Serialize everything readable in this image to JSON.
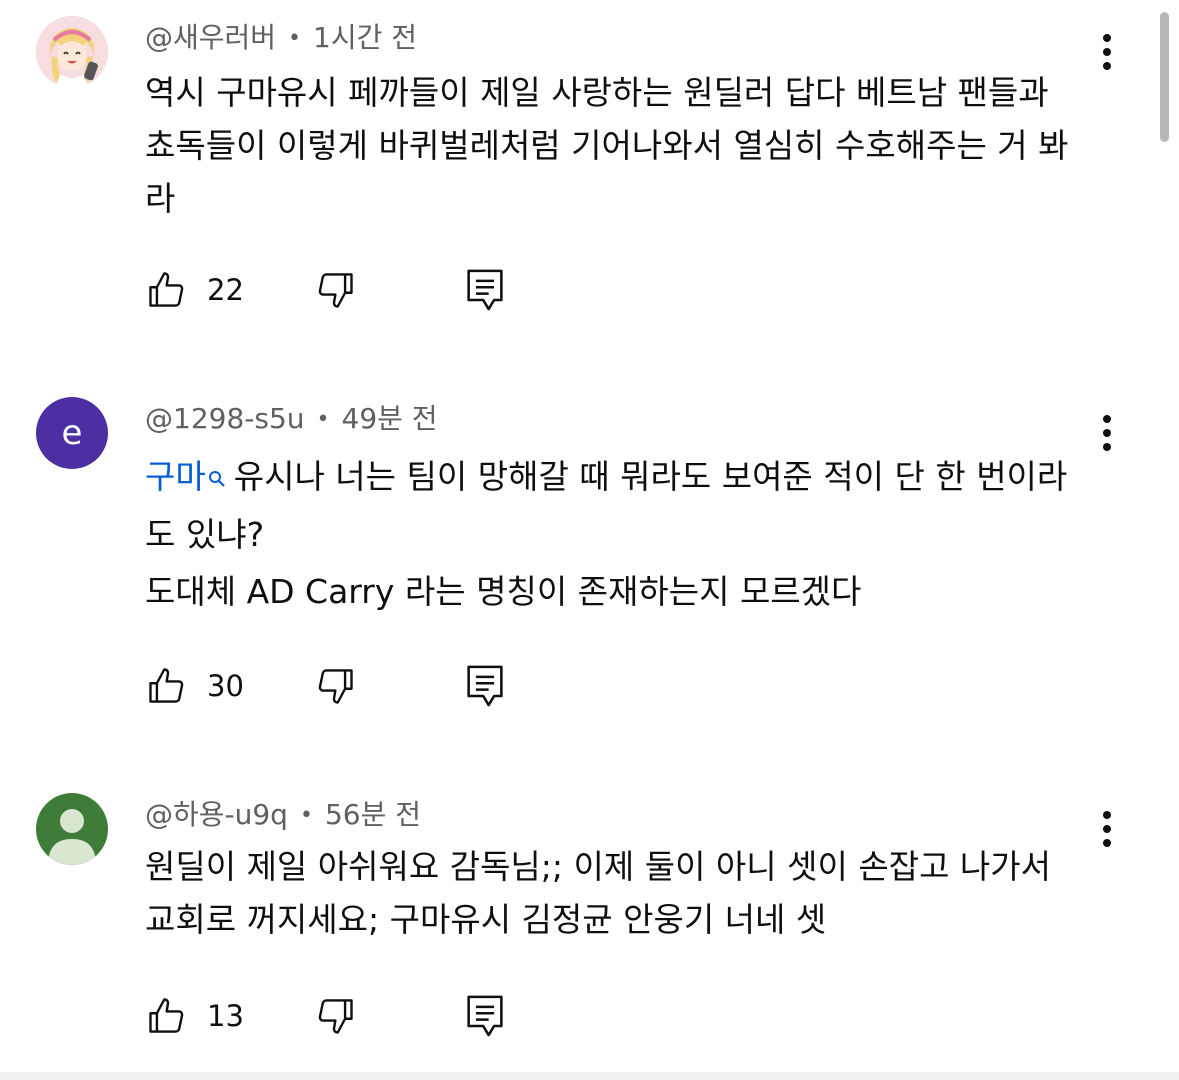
{
  "comments": [
    {
      "author": "@새우러버",
      "time": "1시간 전",
      "lines": [
        "역시 구마유시 페까들이 제일 사랑하는 원딜러 답다 베트남 팬들과",
        "쵸독들이 이렇게 바퀴벌레처럼 기어나와서 열심히 수호해주는 거 봐",
        "라"
      ],
      "likes": "22",
      "avatar_type": "illustration"
    },
    {
      "author": "@1298-s5u",
      "time": "49분 전",
      "link_text": "구마",
      "lines": [
        "유시나 너는 팀이 망해갈 때 뭐라도 보여준 적이 단 한 번이라",
        "도 있냐?",
        "도대체 AD Carry 라는 명칭이 존재하는지 모르겠다"
      ],
      "likes": "30",
      "avatar_type": "letter",
      "avatar_letter": "e",
      "avatar_color": "#4b2fa3"
    },
    {
      "author": "@하용-u9q",
      "time": "56분 전",
      "lines": [
        "원딜이 제일 아쉬워요 감독님;; 이제 둘이 아니 셋이 손잡고 나가서",
        "교회로 꺼지세요; 구마유시 김정균 안웅기 너네 셋"
      ],
      "likes": "13",
      "avatar_type": "default",
      "avatar_color": "#3f7c3a"
    }
  ],
  "colors": {
    "meta": "#606060",
    "text": "#0f0f0f",
    "link": "#065fd4"
  },
  "icons": [
    "like-icon",
    "dislike-icon",
    "reply-icon",
    "more-vert-icon",
    "search-icon"
  ]
}
